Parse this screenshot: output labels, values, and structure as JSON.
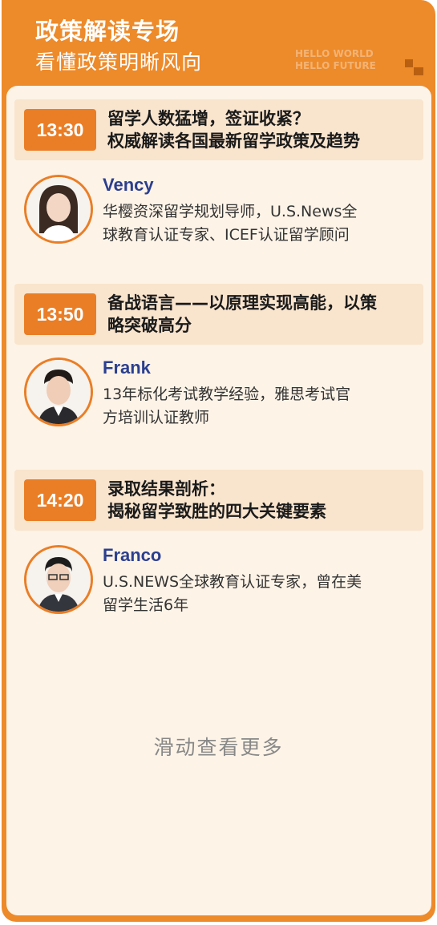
{
  "header": {
    "title": "政策解读专场",
    "subtitle": "看懂政策明晰风向",
    "watermark_line1": "HELLO WORLD",
    "watermark_line2": "HELLO FUTURE"
  },
  "sessions": [
    {
      "time": "13:30",
      "title_line1": "留学人数猛增，签证收紧？",
      "title_line2": "权威解读各国最新留学政策及趋势",
      "speaker_name": "Vency",
      "speaker_desc_line1": "华樱资深留学规划导师，U.S.News全",
      "speaker_desc_line2": "球教育认证专家、ICEF认证留学顾问"
    },
    {
      "time": "13:50",
      "title_line1": "备战语言——以原理实现高能，以策",
      "title_line2": "略突破高分",
      "speaker_name": "Frank",
      "speaker_desc_line1": "13年标化考试教学经验，雅思考试官",
      "speaker_desc_line2": "方培训认证教师"
    },
    {
      "time": "14:20",
      "title_line1": "录取结果剖析：",
      "title_line2": "揭秘留学致胜的四大关键要素",
      "speaker_name": "Franco",
      "speaker_desc_line1": "U.S.NEWS全球教育认证专家，曾在美",
      "speaker_desc_line2": "留学生活6年"
    }
  ],
  "footer": {
    "scroll_hint": "滑动查看更多"
  },
  "colors": {
    "primary_orange": "#ed8a2a",
    "accent_blue": "#7fdcf7",
    "panel_bg": "#fdf3e7",
    "bar_bg": "#f9e4cd",
    "name_blue": "#2b3f8f"
  }
}
